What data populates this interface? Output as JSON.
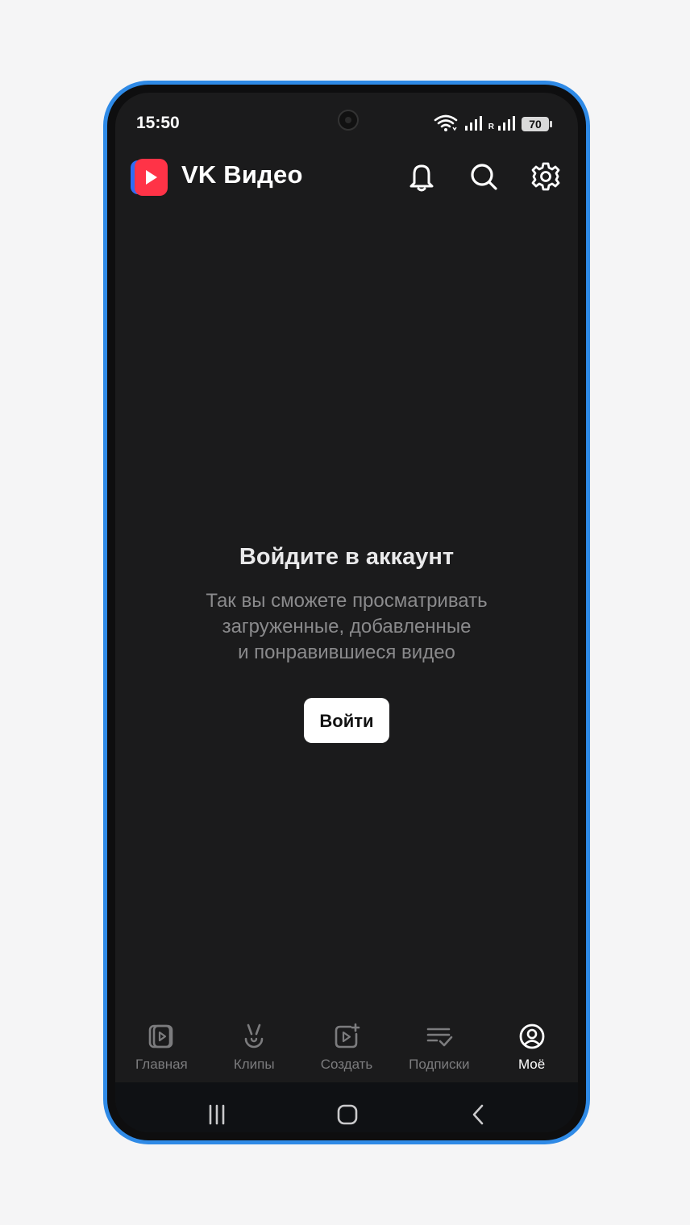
{
  "status_bar": {
    "time": "15:50",
    "roaming": "R",
    "battery": "70"
  },
  "header": {
    "title": "VK Видео",
    "logo": "vk-video-logo",
    "icons": [
      "bell-icon",
      "search-icon",
      "settings-icon"
    ]
  },
  "empty_state": {
    "title": "Войдите в аккаунт",
    "description_line1": "Так вы сможете просматривать",
    "description_line2": "загруженные, добавленные",
    "description_line3": "и понравившиеся видео",
    "button_label": "Войти"
  },
  "bottom_nav": {
    "items": [
      {
        "label": "Главная",
        "icon": "home-video-icon",
        "active": false
      },
      {
        "label": "Клипы",
        "icon": "clips-icon",
        "active": false
      },
      {
        "label": "Создать",
        "icon": "create-video-icon",
        "active": false
      },
      {
        "label": "Подписки",
        "icon": "subscriptions-icon",
        "active": false
      },
      {
        "label": "Моё",
        "icon": "profile-icon",
        "active": true
      }
    ]
  },
  "system_nav": [
    "recents-button",
    "home-button",
    "back-button"
  ],
  "colors": {
    "frame": "#2f8ae6",
    "screen_bg": "#1b1b1c",
    "logo_red": "#ff3347",
    "logo_blue": "#2f6cf5",
    "active_label": "#ffffff",
    "inactive_label": "#7c7c7e"
  }
}
